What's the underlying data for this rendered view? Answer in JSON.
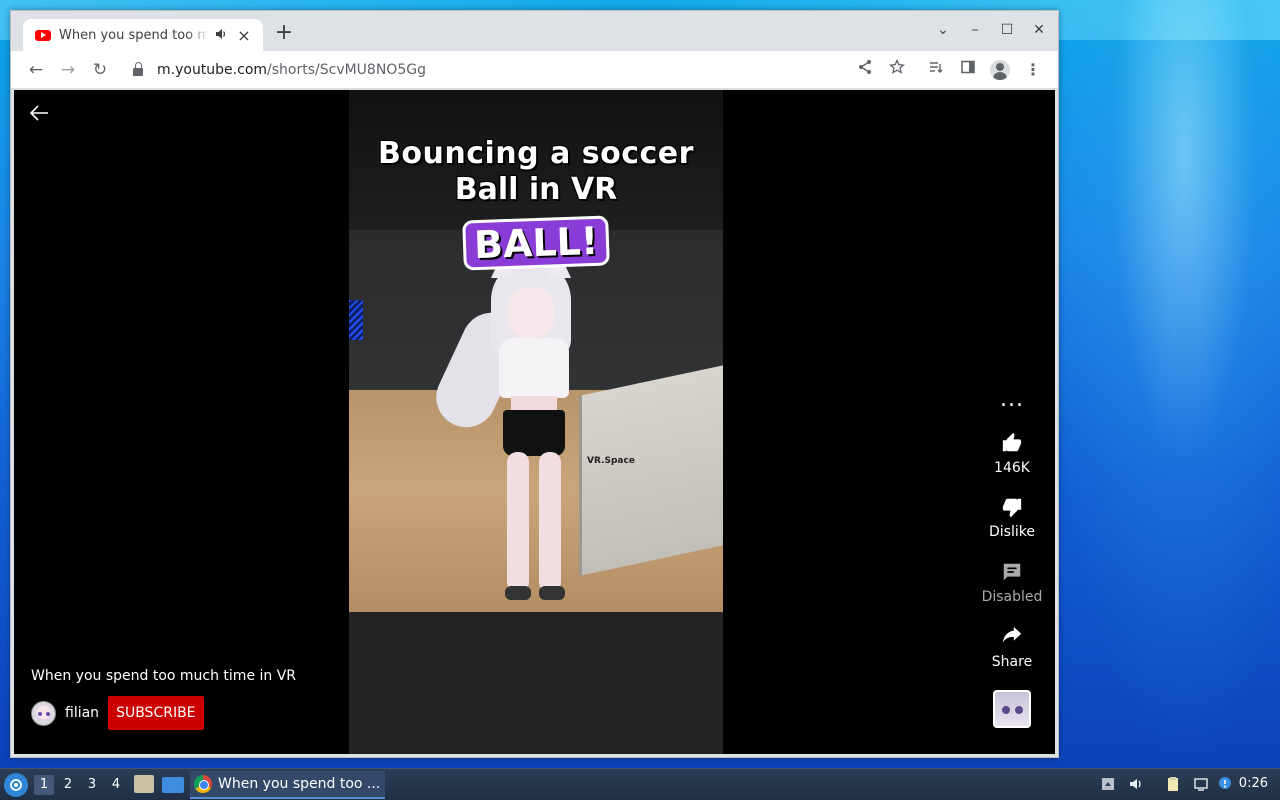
{
  "browser": {
    "tab": {
      "title": "When you spend too much time in VR - YouTube",
      "audio_icon": "speaker-icon",
      "close": "×"
    },
    "new_tab": "+",
    "window_controls": [
      "⌄",
      "–",
      "☐",
      "✕"
    ],
    "nav": {
      "back": "←",
      "forward": "→",
      "reload": "↻"
    },
    "url_host": "m.youtube.com",
    "url_path": "/shorts/ScvMU8NO5Gg",
    "toolbar_icons": [
      "share-icon",
      "star-icon",
      "reading-list-icon",
      "side-panel-icon",
      "profile-icon",
      "menu-icon"
    ]
  },
  "colors": {
    "subscribe": "#cc0000",
    "caption_badge": "#8a3cd6",
    "youtube_red": "#ff0000"
  },
  "video": {
    "caption_line1": "Bouncing a soccer",
    "caption_line2": "Ball in VR",
    "caption_badge": "BALL!",
    "watermark": "VR.Space"
  },
  "actions": {
    "more": "...",
    "like_count": "146K",
    "dislike_label": "Dislike",
    "comments_label": "Disabled",
    "share_label": "Share"
  },
  "meta": {
    "title": "When you spend too much time in VR",
    "channel": "filian",
    "subscribe_label": "SUBSCRIBE"
  },
  "taskbar": {
    "workspaces": [
      "1",
      "2",
      "3",
      "4"
    ],
    "active_workspace": "1",
    "task_label": "When you spend too ...",
    "clock": "0:26"
  }
}
